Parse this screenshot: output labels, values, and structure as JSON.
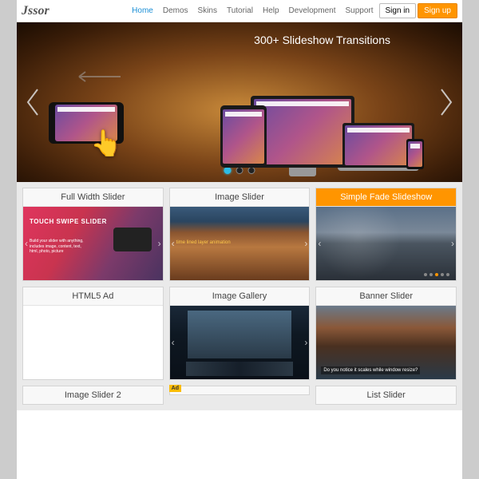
{
  "nav": {
    "brand": "Jssor",
    "items": [
      "Home",
      "Demos",
      "Skins",
      "Tutorial",
      "Help",
      "Development",
      "Support"
    ],
    "active_index": 0,
    "signin": "Sign in",
    "signup": "Sign up"
  },
  "hero": {
    "title": "300+ Slideshow Transitions",
    "active_dot": 0,
    "dot_count": 3
  },
  "cards": [
    {
      "title": "Full Width Slider",
      "kind": "t1",
      "overlay": "TOUCH SWIPE\nSLIDER",
      "sub": "Build your slider with anything, includes image, content, text, html, photo, picture"
    },
    {
      "title": "Image Slider",
      "kind": "t2",
      "overlay": "time lined layer animation"
    },
    {
      "title": "Simple Fade Slideshow",
      "kind": "t3",
      "highlight": true
    },
    {
      "title": "HTML5 Ad",
      "kind": "blank"
    },
    {
      "title": "Image Gallery",
      "kind": "t5"
    },
    {
      "title": "Banner Slider",
      "kind": "t6",
      "overlay": "Do you notice it scales while window resize?"
    }
  ],
  "row4": [
    {
      "title": "Image Slider 2",
      "ad": true,
      "ad_label": "Ad"
    },
    {
      "title": ""
    },
    {
      "title": "List Slider"
    }
  ]
}
